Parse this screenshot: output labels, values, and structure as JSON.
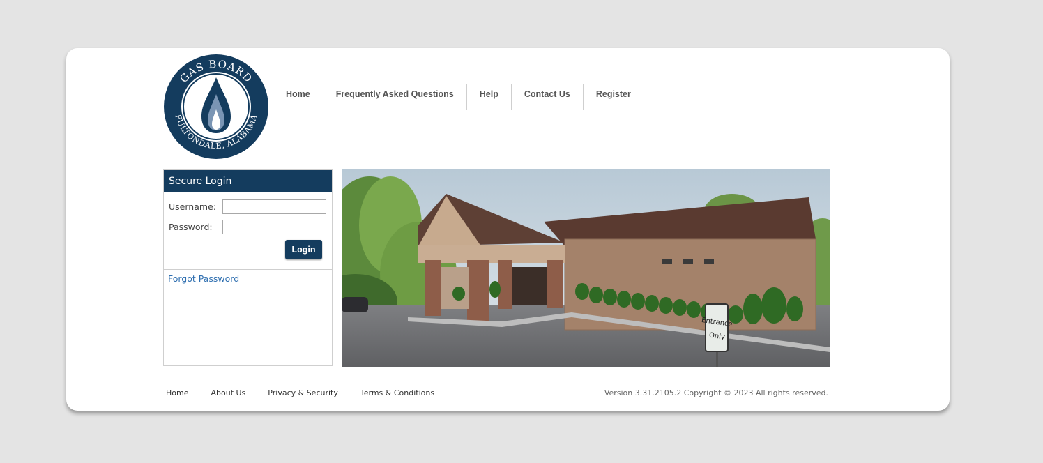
{
  "logo": {
    "top_text": "GAS BOARD",
    "bottom_text": "FULTONDALE, ALABAMA",
    "brand_color": "#143c5e"
  },
  "nav": {
    "items": [
      {
        "label": "Home"
      },
      {
        "label": "Frequently Asked Questions"
      },
      {
        "label": "Help"
      },
      {
        "label": "Contact Us"
      },
      {
        "label": "Register"
      }
    ]
  },
  "login": {
    "title": "Secure Login",
    "username_label": "Username:",
    "username_value": "",
    "password_label": "Password:",
    "password_value": "",
    "button_label": "Login",
    "forgot_label": "Forgot Password"
  },
  "photo": {
    "sign_line1": "Entrance",
    "sign_line2": "Only"
  },
  "footer": {
    "links": [
      {
        "label": "Home"
      },
      {
        "label": "About Us"
      },
      {
        "label": "Privacy & Security"
      },
      {
        "label": "Terms & Conditions"
      }
    ],
    "copyright": "Version 3.31.2105.2 Copyright © 2023 All rights reserved."
  }
}
